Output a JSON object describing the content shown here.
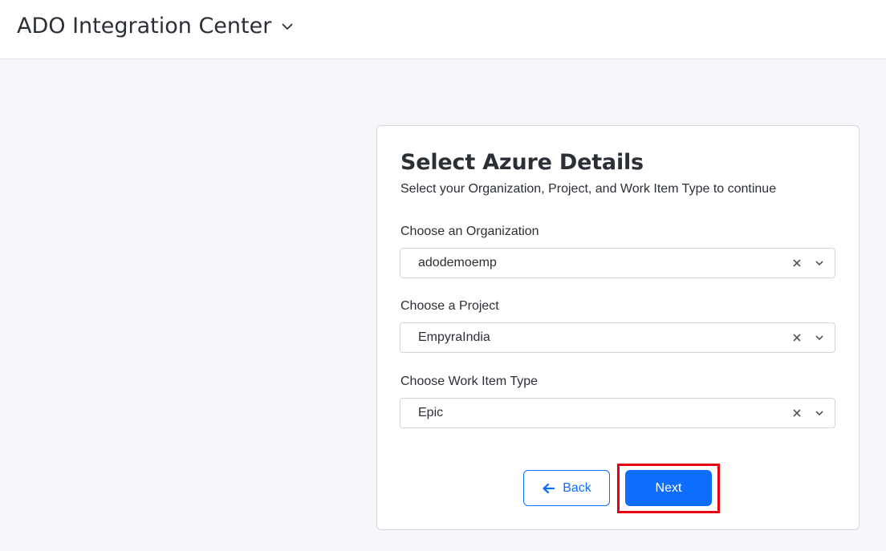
{
  "header": {
    "app_title": "ADO Integration Center"
  },
  "card": {
    "title": "Select Azure Details",
    "subtitle": "Select your Organization, Project, and Work Item Type to continue",
    "fields": [
      {
        "label": "Choose an Organization",
        "value": "adodemoemp"
      },
      {
        "label": "Choose a Project",
        "value": "EmpyraIndia"
      },
      {
        "label": "Choose Work Item Type",
        "value": "Epic"
      }
    ],
    "back_label": "Back",
    "next_label": "Next"
  },
  "colors": {
    "accent": "#0d6efd",
    "highlight": "#e60012"
  }
}
